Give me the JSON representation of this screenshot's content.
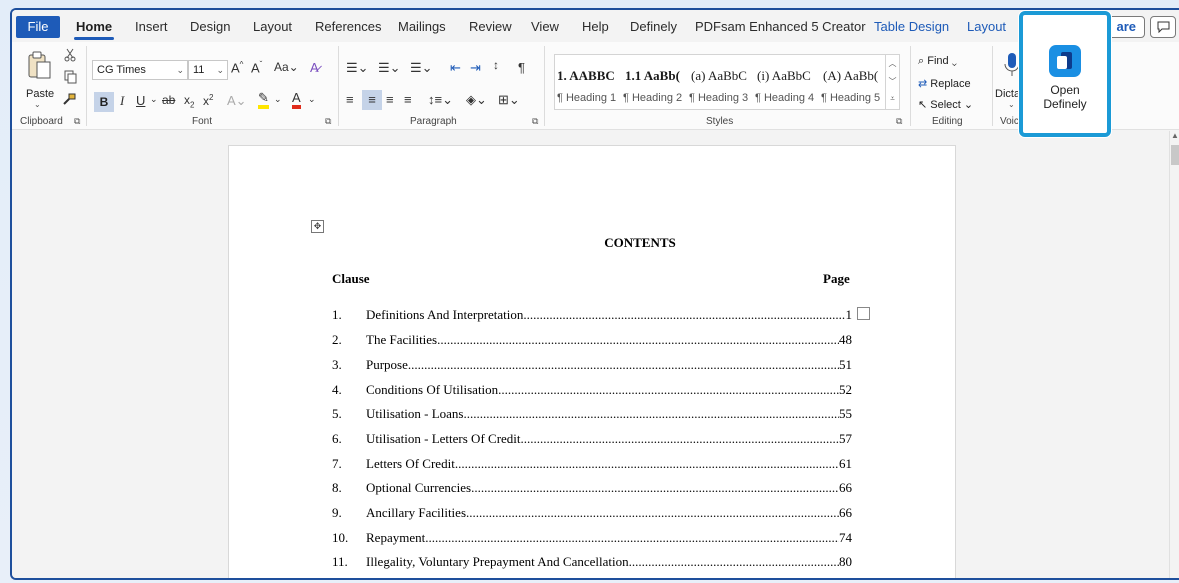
{
  "ribbon_tabs": {
    "file": "File",
    "home": "Home",
    "insert": "Insert",
    "design": "Design",
    "layout": "Layout",
    "references": "References",
    "mailings": "Mailings",
    "review": "Review",
    "view": "View",
    "help": "Help",
    "definely": "Definely",
    "pdfsam": "PDFsam Enhanced 5 Creator",
    "table_design": "Table Design",
    "table_layout": "Layout",
    "share": "are"
  },
  "clipboard": {
    "paste": "Paste",
    "label": "Clipboard"
  },
  "font": {
    "name": "CG Times",
    "size": "11",
    "label": "Font"
  },
  "paragraph": {
    "label": "Paragraph"
  },
  "styles": {
    "label": "Styles",
    "previews": [
      "1. AABBC",
      "1.1 AaBb(",
      "(a) AaBbC",
      "(i) AaBbC",
      "(A) AaBb("
    ],
    "names": [
      "¶ Heading 1",
      "¶ Heading 2",
      "¶ Heading 3",
      "¶ Heading 4",
      "¶ Heading 5"
    ]
  },
  "editing": {
    "find": "Find",
    "replace": "Replace",
    "select": "Select",
    "label": "Editing"
  },
  "voice": {
    "dictate": "Dicta",
    "label": "Voic"
  },
  "definely_button": {
    "line1": "Open",
    "line2": "Definely",
    "accent": "#1b9ad6",
    "icon": "definely-logo-icon"
  },
  "document": {
    "title": "CONTENTS",
    "col_clause": "Clause",
    "col_page": "Page",
    "rows": [
      {
        "num": "1.",
        "text": "Definitions And Interpretation",
        "page": "1"
      },
      {
        "num": "2.",
        "text": "The Facilities ",
        "page": "48"
      },
      {
        "num": "3.",
        "text": "Purpose ",
        "page": "51"
      },
      {
        "num": "4.",
        "text": "Conditions Of Utilisation",
        "page": "52"
      },
      {
        "num": "5.",
        "text": "Utilisation - Loans ",
        "page": "55"
      },
      {
        "num": "6.",
        "text": "Utilisation - Letters Of Credit",
        "page": "57"
      },
      {
        "num": "7.",
        "text": "Letters Of Credit",
        "page": "61"
      },
      {
        "num": "8.",
        "text": "Optional Currencies",
        "page": "66"
      },
      {
        "num": "9.",
        "text": "Ancillary Facilities",
        "page": "66"
      },
      {
        "num": "10.",
        "text": "Repayment",
        "page": "74"
      },
      {
        "num": "11.",
        "text": "Illegality, Voluntary Prepayment And Cancellation ",
        "page": "80"
      }
    ]
  }
}
